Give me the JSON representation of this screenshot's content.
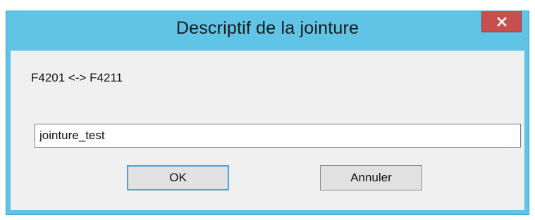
{
  "window": {
    "title": "Descriptif de la jointure",
    "close_icon": "close-icon"
  },
  "dialog": {
    "relation_text": "F4201 <-> F4211",
    "name_input_value": "jointure_test",
    "ok_label": "OK",
    "cancel_label": "Annuler"
  },
  "colors": {
    "titlebar": "#5fc4e6",
    "close_button": "#c7504e",
    "client_background": "#f0f0f0",
    "default_button_border": "#4aa3dc"
  }
}
